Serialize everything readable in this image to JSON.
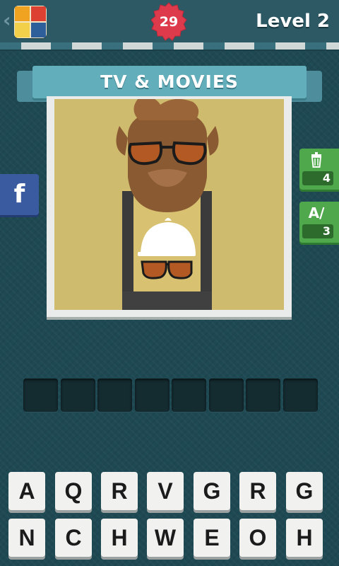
{
  "header": {
    "score": "29",
    "level_title": "Level 2",
    "back_symbol": "‹"
  },
  "category": {
    "title": "TV & MOVIES"
  },
  "puzzle_image": {
    "description_icon": "bearded-man-sunglasses-icon"
  },
  "side_buttons": {
    "facebook_label": "f",
    "remove_letters_hint": {
      "icon": "trash-icon",
      "count": "4"
    },
    "reveal_letter_hint": {
      "icon": "letter-reveal-icon",
      "symbol": "A/",
      "count": "3"
    }
  },
  "answer_slots": 8,
  "keyboard": {
    "row1": [
      "A",
      "Q",
      "R",
      "V",
      "G",
      "R",
      "G"
    ],
    "row2": [
      "N",
      "C",
      "H",
      "W",
      "E",
      "O",
      "H"
    ]
  },
  "colors": {
    "background": "#1e4953",
    "banner": "#63aebb",
    "score_badge": "#dd3b4b",
    "hint_green": "#4fa84b",
    "facebook_blue": "#3b5ba0",
    "image_bg": "#cfbb6e"
  }
}
